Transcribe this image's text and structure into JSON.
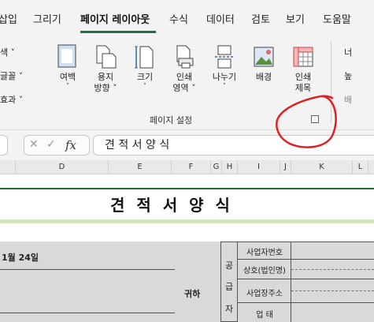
{
  "menu": {
    "items": [
      "삽입",
      "그리기",
      "페이지 레이아웃",
      "수식",
      "데이터",
      "검토",
      "보기",
      "도움말"
    ],
    "active": "페이지 레이아웃"
  },
  "ribbon": {
    "left_partial": [
      "색 ˅",
      "글꼴 ˅",
      "효과 ˅"
    ],
    "buttons": [
      {
        "label1": "여백",
        "label2": "˅",
        "icon": "margins-icon"
      },
      {
        "label1": "용지",
        "label2": "방향 ˅",
        "icon": "orientation-icon"
      },
      {
        "label1": "크기",
        "label2": "˅",
        "icon": "size-icon"
      },
      {
        "label1": "인쇄",
        "label2": "영역 ˅",
        "icon": "print-area-icon"
      },
      {
        "label1": "나누기",
        "label2": "˅",
        "icon": "breaks-icon"
      },
      {
        "label1": "배경",
        "label2": "",
        "icon": "background-icon"
      },
      {
        "label1": "인쇄",
        "label2": "제목",
        "icon": "print-titles-icon"
      }
    ],
    "group_label": "페이지 설정",
    "right_partial": [
      "너",
      "높",
      "배"
    ]
  },
  "formula_bar": {
    "fx": "fx",
    "value": "견   적   서   양   식"
  },
  "columns": [
    "D",
    "E",
    "F",
    "G",
    "H",
    "I",
    "J",
    "K",
    "L"
  ],
  "sheet": {
    "title": "견  적  서  양  식",
    "date": "1월 24일",
    "recipient_suffix": "귀하",
    "supplier_chars": [
      "공",
      "급",
      "자"
    ],
    "field_labels": [
      "사업자번호",
      "상호(법인명)",
      "사업장주소",
      "업   태"
    ]
  },
  "colors": {
    "accent_green": "#1e7145",
    "annotation_red": "#e02020"
  }
}
